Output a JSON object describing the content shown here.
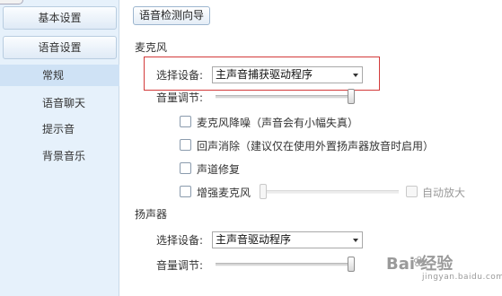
{
  "sidebar": {
    "buttons": [
      {
        "label": "基本设置"
      },
      {
        "label": "语音设置"
      }
    ],
    "items": [
      {
        "label": "常规",
        "active": true
      },
      {
        "label": "语音聊天",
        "active": false
      },
      {
        "label": "提示音",
        "active": false
      },
      {
        "label": "背景音乐",
        "active": false
      }
    ]
  },
  "main": {
    "wizard_button": "语音检测向导",
    "microphone": {
      "section_title": "麦克风",
      "device_label": "选择设备:",
      "device_value": "主声音捕获驱动程序",
      "volume_label": "音量调节:",
      "volume_level": 1.0,
      "options": {
        "noise_reduction": "麦克风降噪（声音会有小幅失真）",
        "echo_cancel": "回声消除（建议仅在使用外置扬声器放音时启用）",
        "channel_repair": "声道修复",
        "boost": "增强麦克风",
        "auto_amplify": "自动放大"
      },
      "boost_level": 0.0
    },
    "speaker": {
      "section_title": "扬声器",
      "device_label": "选择设备:",
      "device_value": "主声音驱动程序",
      "volume_label": "音量调节:",
      "volume_level": 1.0
    }
  },
  "watermark": {
    "brand": "Bai  经验",
    "sub": "jingyan.baidu.com"
  },
  "colors": {
    "sidebar_bg": "#e6f1fb",
    "active_item_bg": "#cfe2f5",
    "highlight_border": "#d33a3a"
  }
}
